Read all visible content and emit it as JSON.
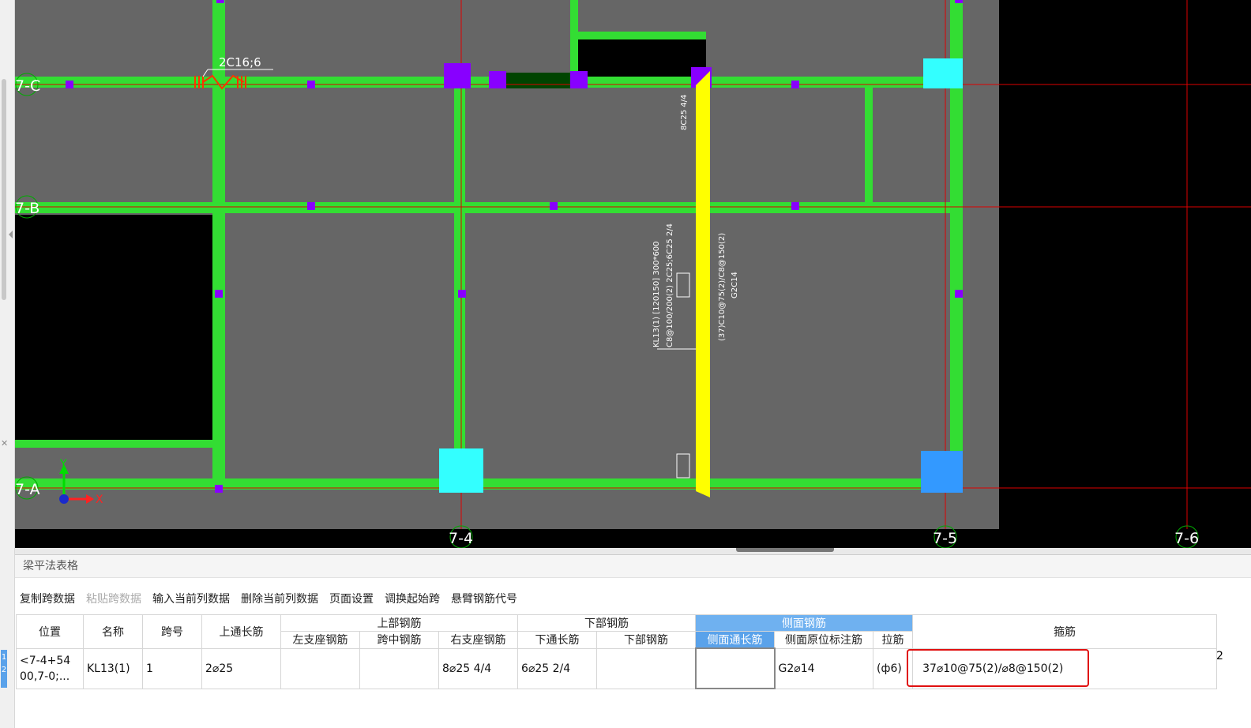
{
  "canvas": {
    "axis_labels": {
      "row_c": "7-C",
      "row_b": "7-B",
      "row_a": "7-A",
      "col_4": "7-4",
      "col_5": "7-5",
      "col_6": "7-6"
    },
    "coord_x": "X",
    "coord_y": "Y",
    "rebar_note": "2C16;6",
    "vertical_note_top": "8C25 4/4",
    "beam_label_line1": "KL13(1) [120150] 300*600",
    "beam_label_line2": "C8@100/200(2) 2C25;6C25 2/4",
    "beam_label_right1": "(37)C10@75(2)/C8@150(2)",
    "beam_label_right2": "G2C14",
    "colors": {
      "beam": "#33dd33",
      "highlight_beam": "#ffff00",
      "grid_line": "#dd0000",
      "column_cyan": "#33ffff",
      "column_blue": "#3399ff",
      "node": "#8800ff",
      "slab": "#666666"
    }
  },
  "panel": {
    "title": "梁平法表格",
    "toolbar": [
      {
        "label": "复制跨数据",
        "enabled": true
      },
      {
        "label": "粘贴跨数据",
        "enabled": false
      },
      {
        "label": "输入当前列数据",
        "enabled": true
      },
      {
        "label": "删除当前列数据",
        "enabled": true
      },
      {
        "label": "页面设置",
        "enabled": true
      },
      {
        "label": "调换起始跨",
        "enabled": true
      },
      {
        "label": "悬臂钢筋代号",
        "enabled": true
      }
    ],
    "headers": {
      "position": "位置",
      "name": "名称",
      "span": "跨号",
      "top_long": "上通长筋",
      "top_group": "上部钢筋",
      "left_support": "左支座钢筋",
      "mid_span": "跨中钢筋",
      "right_support": "右支座钢筋",
      "bottom_group": "下部钢筋",
      "bottom_long": "下通长筋",
      "bottom_bar": "下部钢筋",
      "side_group": "侧面钢筋",
      "side_long": "侧面通长筋",
      "side_in_situ": "侧面原位标注筋",
      "tie": "拉筋",
      "stirrup": "箍筋"
    },
    "row_numbers": [
      "1",
      "2"
    ],
    "row": {
      "position": "<7-4+5400,7-0;...",
      "position_line1": "<7-4+54",
      "position_line2": "00,7-0;...",
      "name": "KL13(1)",
      "span": "1",
      "top_long": "2⌀25",
      "left_support": "",
      "mid_span": "",
      "right_support": "8⌀25 4/4",
      "bottom_long": "6⌀25 2/4",
      "bottom_bar": "",
      "side_long": "",
      "side_in_situ": "G2⌀14",
      "tie": "(ф6)",
      "stirrup": "37⌀10@75(2)/⌀8@150(2)",
      "extra": "2"
    }
  }
}
